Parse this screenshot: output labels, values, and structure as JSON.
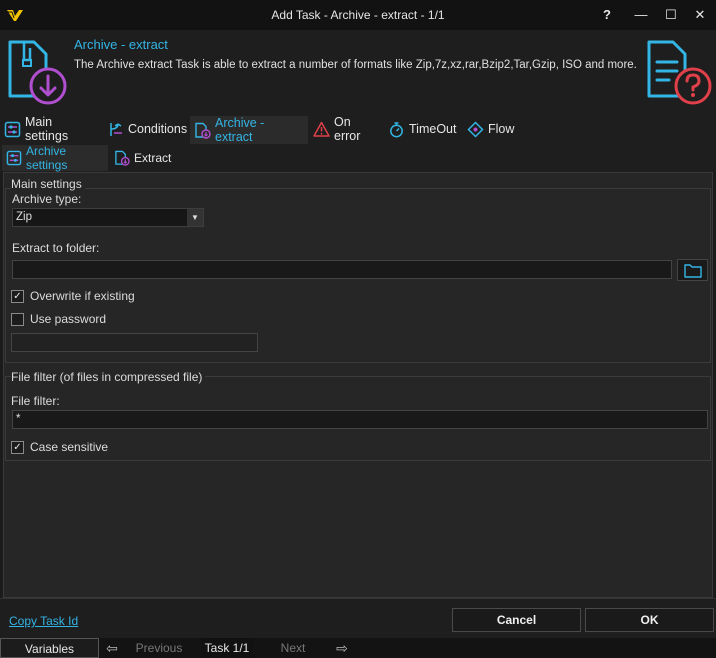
{
  "window": {
    "title": "Add Task - Archive - extract - 1/1",
    "help_label": "?",
    "minimize_label": "—",
    "maximize_label": "☐",
    "close_label": "✕"
  },
  "header": {
    "title": "Archive - extract",
    "description": "The Archive extract Task is able to extract a number of formats like Zip,7z,xz,rar,Bzip2,Tar,Gzip, ISO and more."
  },
  "tabs": [
    {
      "label": "Main settings",
      "icon": "sliders-icon"
    },
    {
      "label": "Conditions",
      "icon": "branch-icon"
    },
    {
      "label": "Archive - extract",
      "icon": "archive-icon"
    },
    {
      "label": "On error",
      "icon": "warning-icon"
    },
    {
      "label": "TimeOut",
      "icon": "stopwatch-icon"
    },
    {
      "label": "Flow",
      "icon": "flow-icon"
    }
  ],
  "subtabs": [
    {
      "label": "Archive settings",
      "icon": "sliders-icon"
    },
    {
      "label": "Extract",
      "icon": "archive-icon"
    }
  ],
  "main_settings": {
    "group_title": "Main settings",
    "archive_type_label": "Archive type:",
    "archive_type_value": "Zip",
    "extract_folder_label": "Extract to folder:",
    "extract_folder_value": "",
    "overwrite_label": "Overwrite if existing",
    "overwrite_checked": true,
    "use_password_label": "Use password",
    "use_password_checked": false,
    "password_value": ""
  },
  "file_filter": {
    "group_title": "File filter (of files in compressed file)",
    "filter_label": "File filter:",
    "filter_value": "*",
    "case_sensitive_label": "Case sensitive",
    "case_sensitive_checked": true
  },
  "footer": {
    "copy_task_id": "Copy Task Id",
    "cancel": "Cancel",
    "ok": "OK"
  },
  "statusbar": {
    "variables": "Variables",
    "previous": "Previous",
    "task_position": "Task 1/1",
    "next": "Next"
  },
  "colors": {
    "accent": "#33b5e5",
    "icon_purple": "#b04fcf",
    "icon_red": "#e0404a",
    "background": "#262626"
  }
}
